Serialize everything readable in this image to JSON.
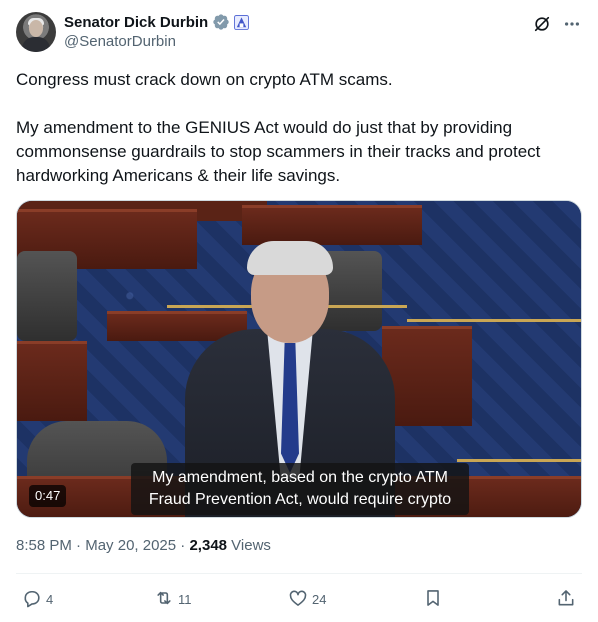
{
  "author": {
    "display_name": "Senator Dick Durbin",
    "handle": "@SenatorDurbin"
  },
  "header_icons": [
    "verified-badge-icon",
    "government-badge-icon",
    "grok-icon",
    "more-icon"
  ],
  "tweet": {
    "paragraphs": [
      "Congress must crack down on crypto ATM scams.",
      "My amendment to the GENIUS Act would do just that by providing commonsense guardrails to stop scammers in their tracks and protect hardworking Americans & their life savings."
    ]
  },
  "media": {
    "caption_line1": "My amendment, based on the crypto ATM",
    "caption_line2": "Fraud Prevention Act, would require crypto",
    "duration": "0:47"
  },
  "meta": {
    "time": "8:58 PM",
    "sep1": " · ",
    "date": "May 20, 2025",
    "sep2": " · ",
    "views_count": "2,348",
    "views_label": " Views"
  },
  "actions": {
    "replies": "4",
    "reposts": "11",
    "likes": "24"
  },
  "colors": {
    "text": "#0f1419",
    "secondary": "#536471",
    "verified": "#829aab",
    "divider": "#eff3f4"
  }
}
